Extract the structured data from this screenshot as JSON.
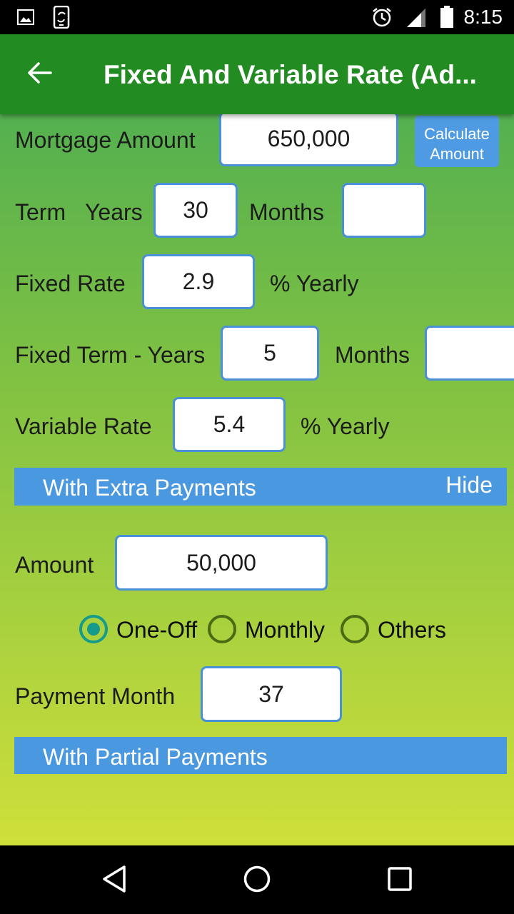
{
  "status_bar": {
    "time": "8:15",
    "left_icons": [
      "image-icon",
      "screen-rotate-icon"
    ],
    "right_icons": [
      "alarm-icon",
      "signal-icon",
      "battery-icon"
    ]
  },
  "app_bar": {
    "title": "Fixed And Variable Rate (Ad...",
    "back_icon": "arrow-left-icon"
  },
  "form": {
    "mortgage_amount": {
      "label": "Mortgage Amount",
      "value": "650,000"
    },
    "calculate_button": {
      "line1": "Calculate",
      "line2": "Amount"
    },
    "term": {
      "label": "Term",
      "years_label": "Years",
      "years_value": "30",
      "months_label": "Months",
      "months_value": ""
    },
    "fixed_rate": {
      "label": "Fixed Rate",
      "value": "2.9",
      "suffix": "% Yearly"
    },
    "fixed_term": {
      "label": "Fixed Term - Years",
      "years_value": "5",
      "months_label": "Months",
      "months_value": ""
    },
    "variable_rate": {
      "label": "Variable Rate",
      "value": "5.4",
      "suffix": "% Yearly"
    }
  },
  "extra_payments": {
    "title": "With Extra Payments",
    "toggle_label": "Hide",
    "amount": {
      "label": "Amount",
      "value": "50,000"
    },
    "frequency_options": [
      {
        "label": "One-Off",
        "selected": true
      },
      {
        "label": "Monthly",
        "selected": false
      },
      {
        "label": "Others",
        "selected": false
      }
    ],
    "payment_month": {
      "label": "Payment Month",
      "value": "37"
    }
  },
  "partial_payments": {
    "title": "With Partial Payments"
  },
  "colors": {
    "app_bar": "#228b22",
    "accent_blue": "#4a98e0",
    "radio_selected": "#159a8c"
  },
  "nav_bar": {
    "buttons": [
      "back-triangle-icon",
      "home-circle-icon",
      "recents-square-icon"
    ]
  }
}
